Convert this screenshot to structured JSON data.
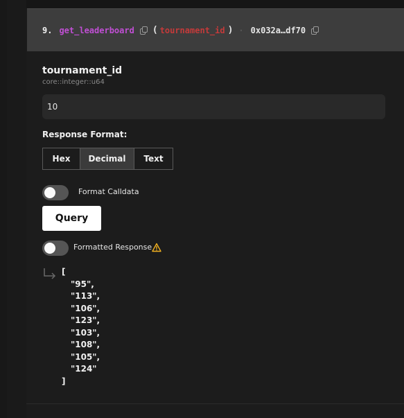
{
  "function": {
    "index": "9.",
    "name": "get_leaderboard",
    "param": "tournament_id",
    "open_paren": "(",
    "close_paren": ")",
    "separator": "·",
    "address": "0x032a…df70"
  },
  "input": {
    "name": "tournament_id",
    "type": "core::integer::u64",
    "value": "10"
  },
  "response_format": {
    "label": "Response Format:",
    "options": [
      "Hex",
      "Decimal",
      "Text"
    ],
    "selected": "Decimal"
  },
  "toggles": {
    "format_calldata": {
      "label": "Format Calldata",
      "on": false
    },
    "formatted_response": {
      "label": "Formatted Response",
      "on": false
    }
  },
  "query_button": "Query",
  "result": {
    "open": "[",
    "items": [
      "\"95\",",
      "\"113\",",
      "\"106\",",
      "\"123\",",
      "\"103\",",
      "\"108\",",
      "\"105\",",
      "\"124\""
    ],
    "close": "]"
  },
  "colors": {
    "function_name": "#c04fd4",
    "param": "#c43a3a",
    "warning": "#f0b020"
  }
}
